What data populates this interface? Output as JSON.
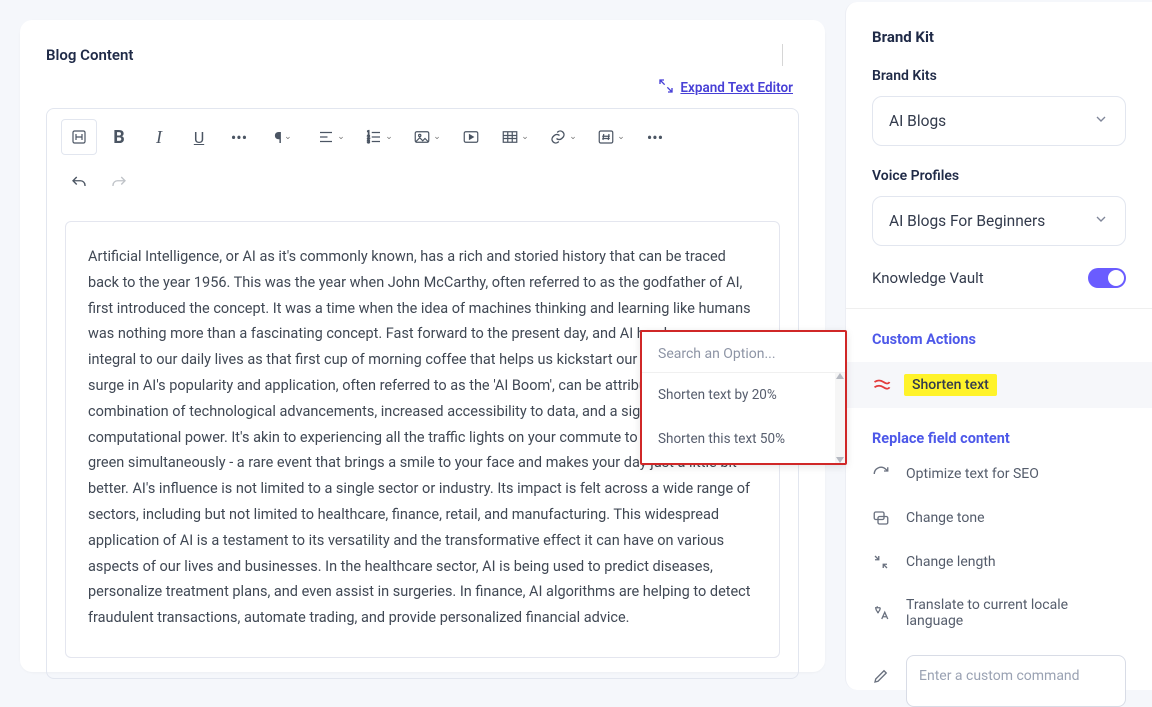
{
  "main": {
    "title": "Blog Content",
    "expand_label": "Expand Text Editor",
    "body": "Artificial Intelligence, or AI as it's commonly known, has a rich and storied history that can be traced back to the year 1956. This was the year when John McCarthy, often referred to as the godfather of AI, first introduced the concept. It was a time when the idea of machines thinking and learning like humans was nothing more than a fascinating concept. Fast forward to the present day, and AI has become as integral to our daily lives as that first cup of morning coffee that helps us kickstart our day. The rapid surge in AI's popularity and application, often referred to as the 'AI Boom', can be attributed to a combination of technological advancements, increased accessibility to data, and a significant boost in computational power. It's akin to experiencing all the traffic lights on your commute to work turning green simultaneously - a rare event that brings a smile to your face and makes your day just a little bit better. AI's influence is not limited to a single sector or industry. Its impact is felt across a wide range of sectors, including but not limited to healthcare, finance, retail, and manufacturing. This widespread application of AI is a testament to its versatility and the transformative effect it can have on various aspects of our lives and businesses. In the healthcare sector, AI is being used to predict diseases, personalize treatment plans, and even assist in surgeries. In finance, AI algorithms are helping to detect fraudulent transactions, automate trading, and provide personalized financial advice."
  },
  "popup": {
    "search_placeholder": "Search an Option...",
    "opt1": "Shorten text by 20%",
    "opt2": "Shorten this text 50%"
  },
  "side": {
    "brand_kit": "Brand Kit",
    "brand_kits_label": "Brand Kits",
    "brand_kits_value": "AI Blogs",
    "voice_label": "Voice Profiles",
    "voice_value": "AI Blogs For Beginners",
    "vault_label": "Knowledge Vault",
    "custom_actions_label": "Custom Actions",
    "shorten_label": "Shorten text",
    "replace_label": "Replace field content",
    "opt_seo": "Optimize text for SEO",
    "opt_tone": "Change tone",
    "opt_len": "Change length",
    "opt_translate": "Translate to current locale language",
    "cmd_placeholder": "Enter a custom command"
  }
}
